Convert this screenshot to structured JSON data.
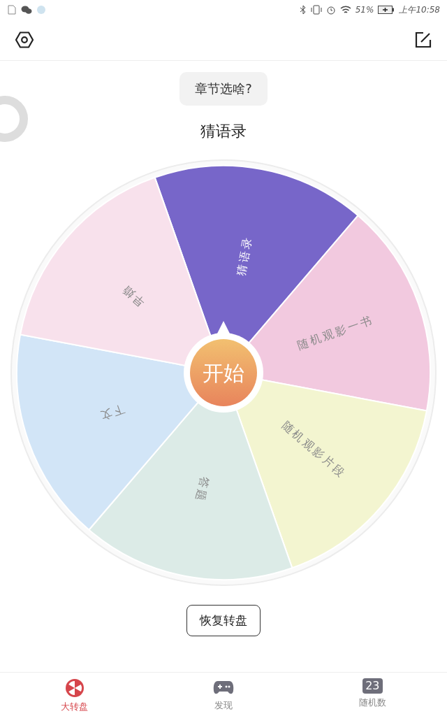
{
  "status_bar": {
    "time": "上午10:58",
    "battery": "51%"
  },
  "prompt": "章节选啥?",
  "result": "猜语录",
  "segments": [
    {
      "label": "猜语录",
      "color": "#7766c9"
    },
    {
      "label": "随机观影一书",
      "color": "#f2c9df"
    },
    {
      "label": "随机观影片段",
      "color": "#f3f5d0"
    },
    {
      "label": "答题",
      "color": "#dcebe7"
    },
    {
      "label": "下文",
      "color": "#d2e5f7"
    },
    {
      "label": "早婚",
      "color": "#f8e1ec"
    }
  ],
  "start_button": "开始",
  "reset_button": "恢复转盘",
  "tabs": [
    {
      "label": "大转盘",
      "kind": "wheel",
      "selected": true
    },
    {
      "label": "发现",
      "kind": "gamepad",
      "selected": false
    },
    {
      "label": "随机数",
      "kind": "number",
      "badge": "23",
      "selected": false
    }
  ]
}
